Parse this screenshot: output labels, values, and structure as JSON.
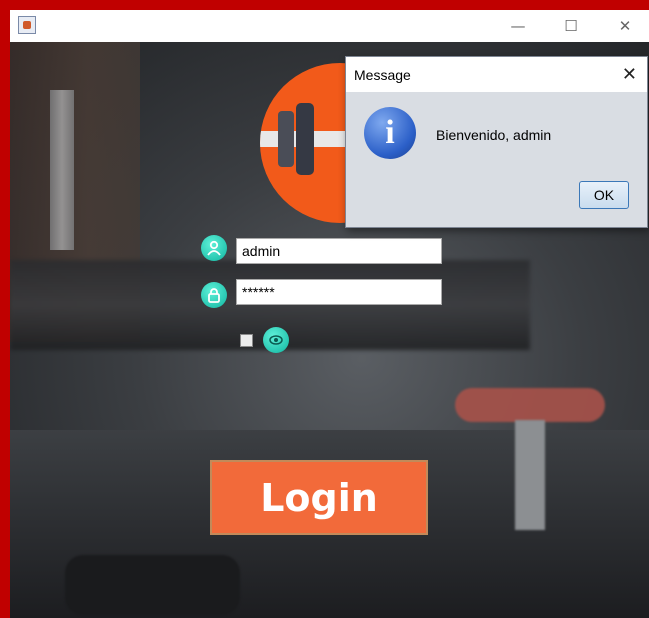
{
  "window": {
    "title": "",
    "minimize_glyph": "—",
    "maximize_glyph": "☐",
    "close_glyph": "✕"
  },
  "login": {
    "username_value": "admin",
    "password_value": "******",
    "show_password_checked": false,
    "login_label": "Login"
  },
  "icons": {
    "app": "java-app-icon",
    "logo": "dumbbell-logo-icon",
    "user": "user-icon",
    "lock": "lock-icon",
    "eye": "eye-icon",
    "info": "information-icon"
  },
  "dialog": {
    "title": "Message",
    "message": "Bienvenido, admin",
    "ok_label": "OK",
    "close_glyph": "✕",
    "info_glyph": "i"
  },
  "colors": {
    "outer_frame": "#c00000",
    "login_button": "#f26a3a",
    "logo": "#f25a1a",
    "icon_accent": "#10b5a0",
    "dialog_bg": "#d9dde3"
  }
}
